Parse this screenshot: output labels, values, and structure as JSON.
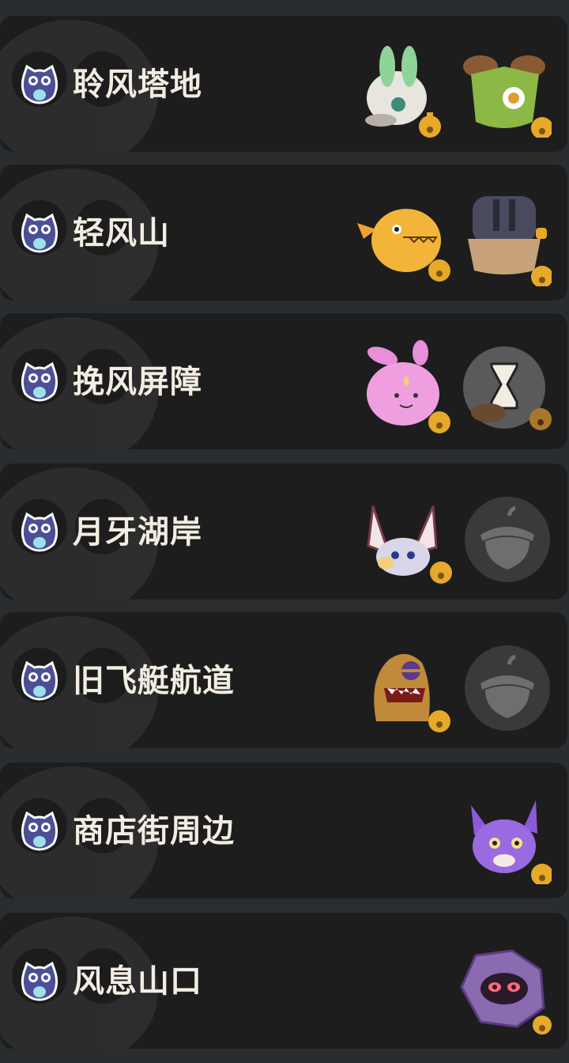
{
  "locations": [
    {
      "name": "聆风塔地",
      "creatures": [
        "green-rabbit-creature",
        "green-leaf-cat-creature"
      ]
    },
    {
      "name": "轻风山",
      "creatures": [
        "orange-fish-creature",
        "hooded-armor-creature"
      ]
    },
    {
      "name": "挽风屏障",
      "creatures": [
        "pink-bunny-creature",
        "hourglass-pending-creature"
      ]
    },
    {
      "name": "月牙湖岸",
      "creatures": [
        "long-eared-bat-creature",
        "locked-acorn-slot"
      ]
    },
    {
      "name": "旧飞艇航道",
      "creatures": [
        "mud-monster-creature",
        "locked-acorn-slot"
      ]
    },
    {
      "name": "商店街周边",
      "creatures": [
        "purple-fox-creature"
      ]
    },
    {
      "name": "风息山口",
      "creatures": [
        "purple-rock-creature"
      ]
    }
  ],
  "colors": {
    "row_bg": "#1d1d1d",
    "page_bg": "#2a2d30",
    "text": "#f2ece2",
    "owl_icon": "#4b4f96",
    "bell": "#e6a92a"
  }
}
